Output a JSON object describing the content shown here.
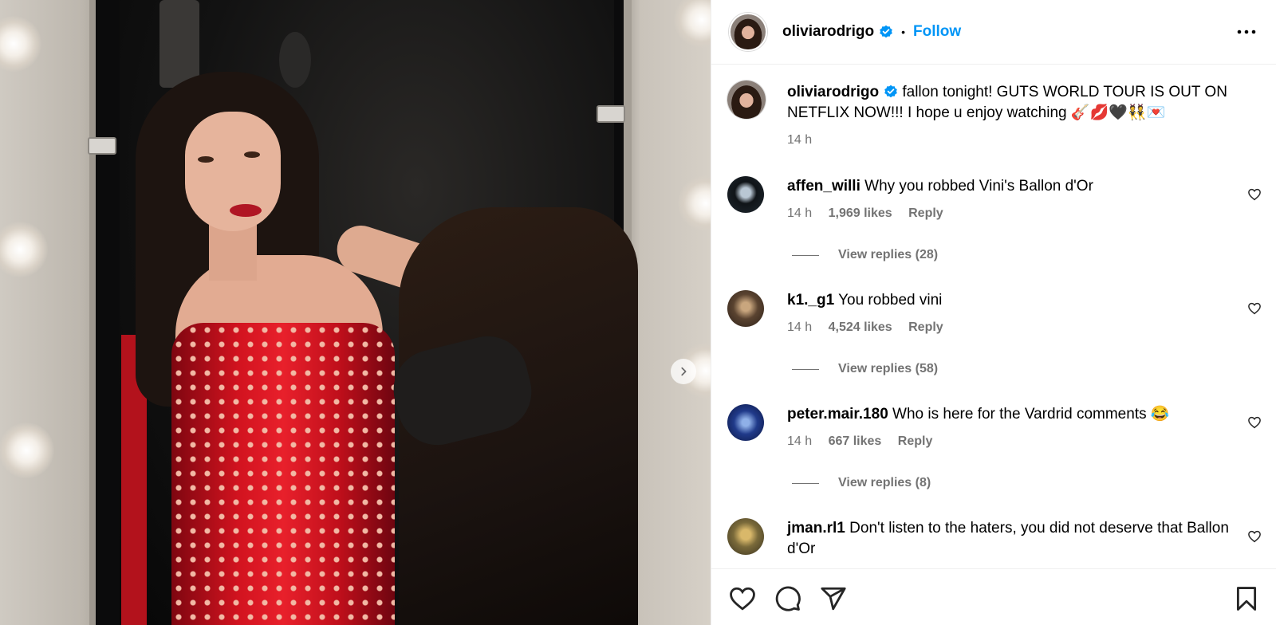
{
  "post": {
    "author": "oliviarodrigo",
    "follow_label": "Follow",
    "separator": "•",
    "caption": "fallon tonight! GUTS WORLD TOUR IS OUT ON NETFLIX NOW!!! I hope u enjoy watching 🎸💋🖤👯💌",
    "caption_time": "14 h"
  },
  "comments": [
    {
      "username": "affen_willi",
      "text": "Why you robbed Vini's Ballon d'Or",
      "time": "14 h",
      "likes": "1,969 likes",
      "reply": "Reply",
      "view_replies": "View replies (28)"
    },
    {
      "username": "k1._g1",
      "text": "You robbed vini",
      "time": "14 h",
      "likes": "4,524 likes",
      "reply": "Reply",
      "view_replies": "View replies (58)"
    },
    {
      "username": "peter.mair.180",
      "text": "Who is here for the Vardrid comments 😂",
      "time": "14 h",
      "likes": "667 likes",
      "reply": "Reply",
      "view_replies": "View replies (8)"
    },
    {
      "username": "jman.rl1",
      "text": "Don't listen to the haters, you did not deserve that Ballon d'Or"
    }
  ],
  "icons": {
    "verified": "verified-badge-icon",
    "more": "more-options-icon",
    "like": "heart-icon",
    "comment": "comment-icon",
    "share": "share-icon",
    "save": "bookmark-icon",
    "next": "chevron-right-icon"
  },
  "colors": {
    "link": "#0095f6",
    "muted": "#737373",
    "verified": "#0095f6",
    "border": "#efefef"
  }
}
